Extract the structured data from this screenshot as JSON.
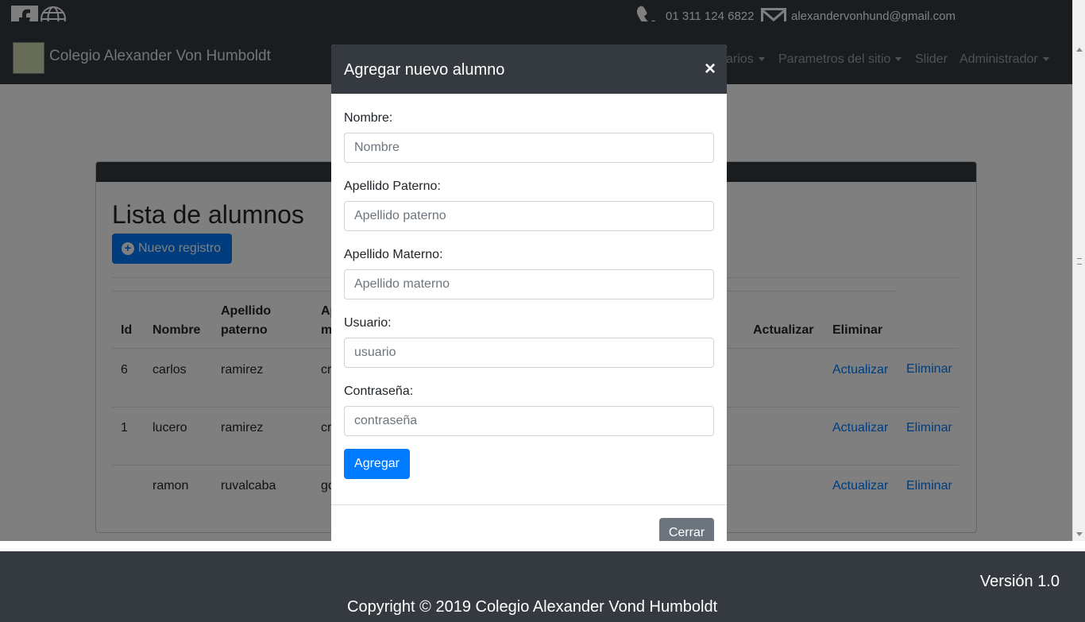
{
  "topbar": {
    "phone": "01 311 124 6822",
    "email": "alexandervonhund@gmail.com",
    "icons": [
      "facebook-icon",
      "globe-icon",
      "phone-icon",
      "mail-icon"
    ]
  },
  "navbar": {
    "brand": "Colegio Alexander Von Humboldt",
    "items": [
      {
        "label": "arios",
        "dropdown": true
      },
      {
        "label": "Parametros del sitio",
        "dropdown": true
      },
      {
        "label": "Slider",
        "dropdown": false
      },
      {
        "label": "Administrador",
        "dropdown": true
      }
    ]
  },
  "list": {
    "title": "Lista de alumnos",
    "new_button": "Nuevo registro",
    "headers": {
      "id": "Id",
      "nombre": "Nombre",
      "apellido_paterno_1": "Apellido",
      "apellido_paterno_2": "paterno",
      "apellido_materno_1": "Ap",
      "apellido_materno_2": "m",
      "actualizar": "Actualizar",
      "eliminar": "Eliminar"
    },
    "rows": [
      {
        "id": "6",
        "nombre": "carlos",
        "paterno": "ramirez",
        "materno": "cr",
        "actualizar": "Actualizar",
        "eliminar": "Eliminar"
      },
      {
        "id": "1",
        "nombre": "lucero",
        "paterno": "ramirez",
        "materno": "cr",
        "actualizar": "Actualizar",
        "eliminar": "Eliminar"
      },
      {
        "id": "",
        "nombre": "ramon",
        "paterno": "ruvalcaba",
        "materno": "go",
        "actualizar": "Actualizar",
        "eliminar": "Eliminar"
      }
    ]
  },
  "modal": {
    "title": "Agregar nuevo alumno",
    "close_symbol": "×",
    "fields": [
      {
        "label": "Nombre:",
        "placeholder": "Nombre"
      },
      {
        "label": "Apellido Paterno:",
        "placeholder": "Apellido paterno"
      },
      {
        "label": "Apellido Materno:",
        "placeholder": "Apellido materno"
      },
      {
        "label": "Usuario:",
        "placeholder": "usuario"
      },
      {
        "label": "Contraseña:",
        "placeholder": "contraseña"
      }
    ],
    "submit": "Agregar",
    "close_button": "Cerrar"
  },
  "footer": {
    "version": "Versión 1.0",
    "copyright": "Copyright © 2019 Colegio Alexander Vond Humboldt"
  },
  "colors": {
    "dark": "#343a40",
    "primary": "#007bff",
    "secondary": "#6c757d"
  }
}
